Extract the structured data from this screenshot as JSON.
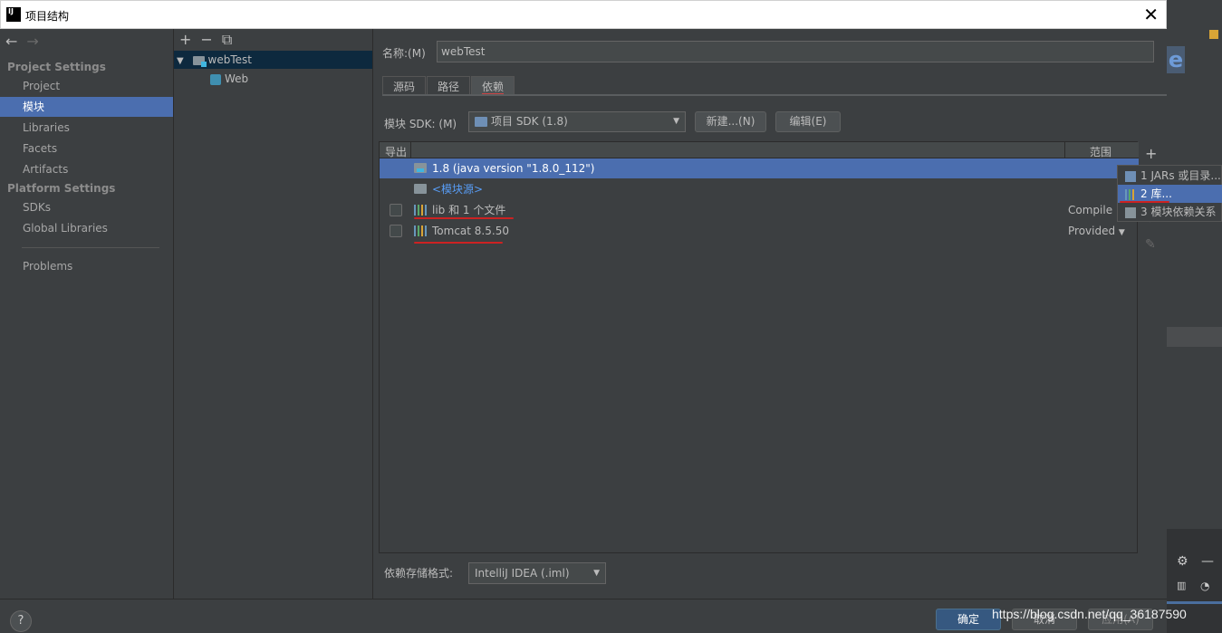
{
  "window": {
    "title": "项目结构",
    "app_icon": "intellij-icon"
  },
  "nav": {
    "project_settings_heading": "Project Settings",
    "project_items": [
      "Project",
      "模块",
      "Libraries",
      "Facets",
      "Artifacts"
    ],
    "platform_settings_heading": "Platform Settings",
    "platform_items": [
      "SDKs",
      "Global Libraries"
    ],
    "problems": "Problems",
    "selected": "模块"
  },
  "tree": {
    "toolbar": [
      "+",
      "−",
      "⧉"
    ],
    "root": "webTest",
    "child": "Web"
  },
  "module": {
    "name_label": "名称:(M)",
    "name_value": "webTest",
    "tabs": [
      "源码",
      "路径",
      "依赖"
    ],
    "active_tab": "依赖",
    "sdk_label": "模块 SDK:  (M)",
    "sdk_value": "项目 SDK (1.8)",
    "new_button": "新建...(N)",
    "edit_button": "编辑(E)",
    "table_header_export": "导出",
    "table_header_scope": "范围",
    "rows": [
      {
        "text": "1.8 (java version \"1.8.0_112\")",
        "scope": "",
        "checkbox": false,
        "selected": true
      },
      {
        "text": "<模块源>",
        "scope": "",
        "checkbox": false,
        "selected": false
      },
      {
        "text": "lib 和 1 个文件",
        "scope": "Compile",
        "checkbox": true,
        "selected": false
      },
      {
        "text": "Tomcat 8.5.50",
        "scope": "Provided",
        "checkbox": true,
        "selected": false
      }
    ],
    "storage_label": "依赖存储格式:",
    "storage_value": "IntelliJ IDEA (.iml)"
  },
  "popup": {
    "items": [
      "1  JARs 或目录...",
      "2  库...",
      "3  模块依赖关系"
    ],
    "selected_index": 1
  },
  "footer": {
    "help": "?",
    "ok": "确定",
    "cancel": "取消",
    "apply": "应用(A)"
  },
  "watermark": "https://blog.csdn.net/qq_36187590",
  "colors": {
    "selection": "#4b6eaf",
    "background": "#3c3f41",
    "link": "#589df6",
    "annotation_red": "#cc2222"
  }
}
